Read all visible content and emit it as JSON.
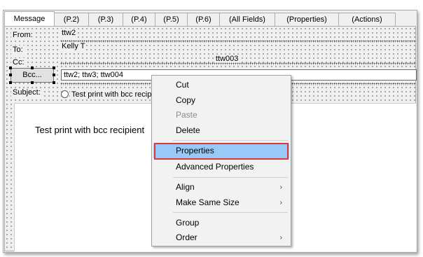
{
  "tabs": [
    {
      "label": "Message",
      "active": true
    },
    {
      "label": "(P.2)"
    },
    {
      "label": "(P.3)"
    },
    {
      "label": "(P.4)"
    },
    {
      "label": "(P.5)"
    },
    {
      "label": "(P.6)"
    },
    {
      "label": "(All Fields)"
    },
    {
      "label": "(Properties)"
    },
    {
      "label": "(Actions)"
    }
  ],
  "form": {
    "from_label": "From:",
    "from_value": "ttw2",
    "to_label": "To:",
    "to_value": "Kelly T",
    "cc_label": "Cc:",
    "cc_value": "ttw003",
    "bcc_button": "Bcc...",
    "bcc_value": "ttw2; ttw3; ttw004",
    "subject_label": "Subject:",
    "subject_value": "Test print with bcc recipi",
    "body_text": "Test print with bcc recipient"
  },
  "context_menu": {
    "items": [
      {
        "label": "Cut"
      },
      {
        "label": "Copy"
      },
      {
        "label": "Paste",
        "disabled": true
      },
      {
        "label": "Delete"
      },
      {
        "label": "Properties",
        "highlighted": true
      },
      {
        "label": "Advanced Properties"
      },
      {
        "label": "Align",
        "submenu": true
      },
      {
        "label": "Make Same Size",
        "submenu": true
      },
      {
        "label": "Group"
      },
      {
        "label": "Order",
        "submenu": true
      }
    ],
    "submenu_arrow": "›"
  },
  "colors": {
    "highlight": "#99c9f6",
    "callout_border": "#d83a3a"
  }
}
